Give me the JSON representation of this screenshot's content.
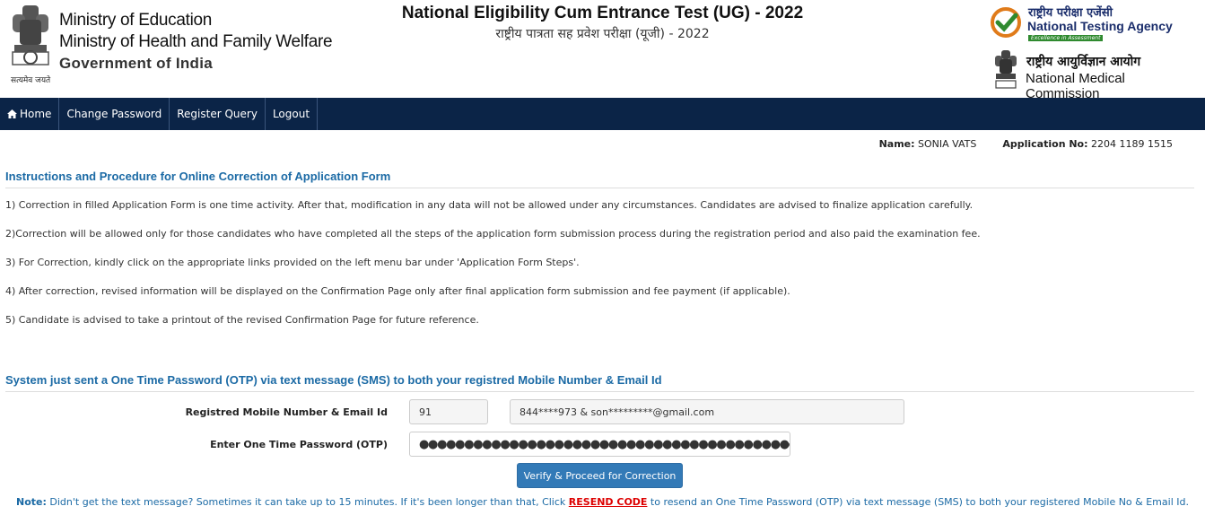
{
  "header": {
    "ministry_lines": [
      "Ministry of Education",
      "Ministry of Health and Family Welfare"
    ],
    "government": "Government of India",
    "emblem_motto": "सत्यमेव जयते",
    "title": "National Eligibility Cum Entrance Test (UG) - 2022",
    "title_hindi": "राष्ट्रीय पात्रता सह प्रवेश परीक्षा (यूजी) - 2022",
    "nta_hindi": "राष्ट्रीय परीक्षा एजेंसी",
    "nta_name": "National Testing Agency",
    "nta_tagline": "Excellence in Assessment",
    "nmc_hindi": "राष्ट्रीय आयुर्विज्ञान आयोग",
    "nmc_name": "National Medical Commission"
  },
  "nav": {
    "items": [
      {
        "label": "Home",
        "icon": "home-icon"
      },
      {
        "label": "Change Password"
      },
      {
        "label": "Register Query"
      },
      {
        "label": "Logout"
      }
    ]
  },
  "user": {
    "name_label": "Name:",
    "name": "SONIA VATS",
    "app_label": "Application No:",
    "app_no": "2204 1189 1515"
  },
  "instructions": {
    "title": "Instructions and Procedure for Online Correction of Application Form",
    "items": [
      "1) Correction in filled Application Form is one time activity. After that, modification in any data will not be allowed under any circumstances. Candidates are advised to finalize application carefully.",
      "2)Correction will be allowed only for those candidates who have completed all the steps of the application form submission process during the registration period and also paid the examination fee.",
      "3) For Correction, kindly click on the appropriate links provided on the left menu bar under 'Application Form Steps'.",
      "4) After correction, revised information will be displayed on the Confirmation Page only after final application form submission and fee payment (if applicable).",
      "5) Candidate is advised to take a printout of the revised Confirmation Page for future reference."
    ]
  },
  "otp": {
    "title": "System just sent a One Time Password (OTP) via text message (SMS) to both your registred Mobile Number & Email Id",
    "mobile_label": "Registred Mobile Number & Email Id",
    "country_code": "91",
    "contact_value": "844****973 & son*********@gmail.com",
    "otp_label": "Enter One Time Password (OTP)",
    "otp_value": "●●●●●●●●●●●●●●●●●●●●●●●●●●●●●●●●●●●●●●●●●●●●●●●●●●●●●●●●●",
    "verify_label": "Verify & Proceed for Correction"
  },
  "note": {
    "label": "Note:",
    "text_before": " Didn't get the text message? Sometimes it can take up to 15 minutes. If it's been longer than that, Click ",
    "link": "RESEND CODE",
    "text_after": " to resend an One Time Password (OTP) via text message (SMS) to both your registered Mobile No & Email Id."
  },
  "colors": {
    "nav_bg": "#0b2447",
    "section_title": "#1b6aa5",
    "button": "#337ab7",
    "resend": "#dd0000"
  }
}
